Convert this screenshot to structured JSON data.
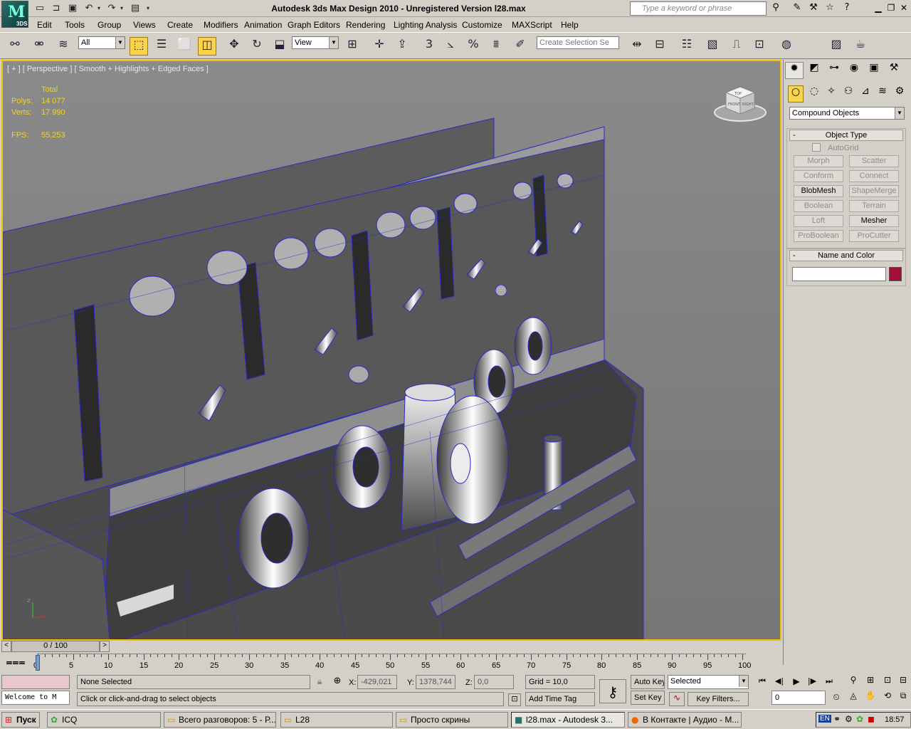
{
  "app": {
    "title": "Autodesk 3ds Max Design 2010  -  Unregistered Version     l28.max",
    "logo_text": "3DS",
    "search_placeholder": "Type a keyword or phrase"
  },
  "menu": [
    "Edit",
    "Tools",
    "Group",
    "Views",
    "Create",
    "Modifiers",
    "Animation",
    "Graph Editors",
    "Rendering",
    "Lighting Analysis",
    "Customize",
    "MAXScript",
    "Help"
  ],
  "toolbar": {
    "selection_filter": "All",
    "ref_coord": "View",
    "snap_labels": [
      "3",
      "%"
    ],
    "named_selection_placeholder": "Create Selection Se"
  },
  "viewport": {
    "label": "[ + ] [ Perspective ] [ Smooth + Highlights + Edged Faces ]",
    "stats": {
      "total_label": "Total",
      "polys_label": "Polys:",
      "polys": "14 077",
      "verts_label": "Verts:",
      "verts": "17 990",
      "fps_label": "FPS:",
      "fps": "55,253"
    },
    "viewcube": {
      "top": "TOP",
      "front": "FRONT",
      "right": "RIGHT"
    }
  },
  "command_panel": {
    "category": "Compound Objects",
    "object_type_title": "Object Type",
    "autogrid": "AutoGrid",
    "buttons": [
      {
        "label": "Morph",
        "enabled": false
      },
      {
        "label": "Scatter",
        "enabled": false
      },
      {
        "label": "Conform",
        "enabled": false
      },
      {
        "label": "Connect",
        "enabled": false
      },
      {
        "label": "BlobMesh",
        "enabled": true
      },
      {
        "label": "ShapeMerge",
        "enabled": false
      },
      {
        "label": "Boolean",
        "enabled": false
      },
      {
        "label": "Terrain",
        "enabled": false
      },
      {
        "label": "Loft",
        "enabled": false
      },
      {
        "label": "Mesher",
        "enabled": true
      },
      {
        "label": "ProBoolean",
        "enabled": false
      },
      {
        "label": "ProCutter",
        "enabled": false
      }
    ],
    "name_color_title": "Name and Color",
    "object_color": "#a0103a"
  },
  "timeline": {
    "frame": "0 / 100",
    "ticks": [
      "0",
      "5",
      "10",
      "15",
      "20",
      "25",
      "30",
      "35",
      "40",
      "45",
      "50",
      "55",
      "60",
      "65",
      "70",
      "75",
      "80",
      "85",
      "90",
      "95",
      "100"
    ]
  },
  "status": {
    "maxscript": "Welcome to M",
    "selection": "None Selected",
    "prompt": "Click or click-and-drag to select objects",
    "x_label": "X:",
    "x": "-429,021",
    "y_label": "Y:",
    "y": "1378,744",
    "z_label": "Z:",
    "z": "0,0",
    "grid": "Grid = 10,0",
    "add_time_tag": "Add Time Tag",
    "auto_key": "Auto Key",
    "set_key": "Set Key",
    "key_mode": "Selected",
    "key_filters": "Key Filters...",
    "current_frame": "0"
  },
  "taskbar": {
    "start": "Пуск",
    "items": [
      {
        "label": "ICQ",
        "icon": "✿"
      },
      {
        "label": "Всего разговоров: 5 - Р...",
        "icon": "▭"
      },
      {
        "label": "L28",
        "icon": "▭"
      },
      {
        "label": "Просто скрины",
        "icon": "▭"
      },
      {
        "label": "l28.max - Autodesk 3...",
        "icon": "■"
      },
      {
        "label": "В Контакте | Аудио - M...",
        "icon": "●"
      }
    ],
    "lang": "EN",
    "clock": "18:57"
  }
}
